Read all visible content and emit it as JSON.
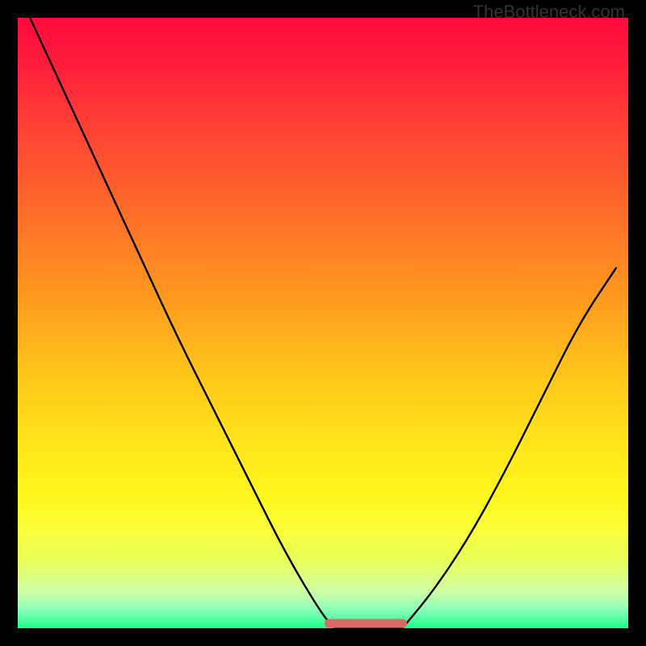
{
  "watermark": "TheBottleneck.com",
  "chart_data": {
    "type": "line",
    "title": "",
    "xlabel": "",
    "ylabel": "",
    "xlim": [
      0,
      100
    ],
    "ylim": [
      0,
      100
    ],
    "series": [
      {
        "name": "left-arm",
        "x": [
          2,
          8,
          14,
          20,
          26,
          32,
          38,
          44,
          50,
          52
        ],
        "y": [
          100,
          87,
          74,
          61,
          48,
          36,
          24,
          12,
          2,
          0
        ]
      },
      {
        "name": "floor",
        "x": [
          52,
          55,
          58,
          61,
          63
        ],
        "y": [
          0,
          0,
          0,
          0,
          0
        ]
      },
      {
        "name": "right-arm",
        "x": [
          63,
          68,
          74,
          80,
          86,
          92,
          98
        ],
        "y": [
          0,
          6,
          15,
          26,
          38,
          50,
          59
        ]
      }
    ],
    "floor_band": {
      "x_start": 51,
      "x_end": 63,
      "color": "#d86a63",
      "thickness_relative": 1.4
    },
    "gradient_stops": [
      {
        "pct": 0,
        "color": "#ff0a3c"
      },
      {
        "pct": 50,
        "color": "#ff9a1e"
      },
      {
        "pct": 78,
        "color": "#fff61a"
      },
      {
        "pct": 100,
        "color": "#1aff8a"
      }
    ]
  }
}
